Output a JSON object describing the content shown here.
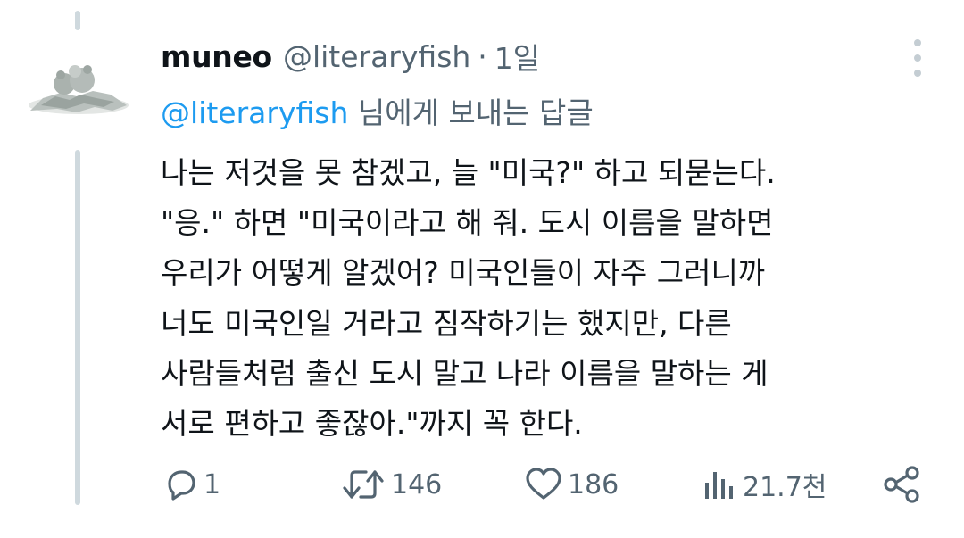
{
  "tweet": {
    "display_name": "muneo",
    "handle": "@literaryfish",
    "separator": "·",
    "time": "1일",
    "reply_to": {
      "mention": "@literaryfish",
      "suffix": " 님에게 보내는 답글"
    },
    "lines": [
      "나는 저것을 못 참겠고, 늘 \"미국?\" 하고 되묻는다.",
      "\"응.\" 하면 \"미국이라고 해 줘. 도시 이름을 말하면",
      "우리가 어떻게 알겠어? 미국인들이 자주 그러니까",
      "너도 미국인일 거라고 짐작하기는 했지만, 다른",
      "사람들처럼 출신 도시 말고 나라 이름을 말하는 게",
      "서로 편하고 좋잖아.\"까지 꼭 한다."
    ]
  },
  "actions": {
    "reply_count": "1",
    "retweet_count": "146",
    "like_count": "186",
    "view_count": "21.7천"
  },
  "colors": {
    "text": "#0f1419",
    "secondary": "#536471",
    "accent": "#1d9bf0"
  },
  "icons": [
    "avatar-image",
    "more-icon",
    "reply-icon",
    "retweet-icon",
    "like-icon",
    "views-icon",
    "share-icon"
  ]
}
